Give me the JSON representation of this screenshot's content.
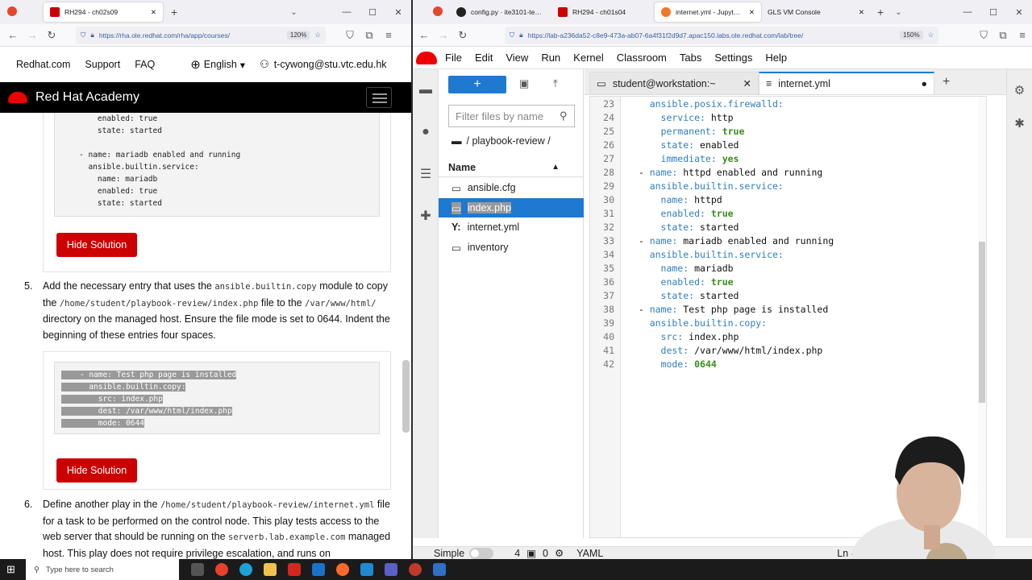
{
  "browser_left": {
    "tabs": [
      {
        "label": "RH294 - ch02s09"
      }
    ],
    "url": "https://rha.ole.redhat.com/rha/app/courses/",
    "zoom": "120%"
  },
  "browser_right": {
    "tabs": [
      {
        "label": "config.py · ite3101-testing"
      },
      {
        "label": "RH294 - ch01s04"
      },
      {
        "label": "internet.yml - JupyterLab"
      },
      {
        "label": "GLS VM Console"
      }
    ],
    "url": "https://lab-a236da52-c8e9-473a-ab07-6a4f31f2d9d7.apac150.labs.ole.redhat.com/lab/tree/",
    "zoom": "150%"
  },
  "rha": {
    "nav": {
      "home": "Redhat.com",
      "support": "Support",
      "faq": "FAQ",
      "language": "English",
      "user": "t-cywong@stu.vtc.edu.hk"
    },
    "brand": "Red Hat Academy",
    "code_top": [
      "    enabled: true",
      "    state: started",
      "",
      "- name: mariadb enabled and running",
      "  ansible.builtin.service:",
      "    name: mariadb",
      "    enabled: true",
      "    state: started"
    ],
    "hide_solution": "Hide Solution",
    "step5": {
      "num": "5.",
      "t1": "Add the necessary entry that uses the ",
      "c1": "ansible.builtin.copy",
      "t2": " module to copy the ",
      "c2": "/home/student/playbook-review/index.php",
      "t3": " file to the ",
      "c3": "/var/www/html/",
      "t4": " directory on the managed host. Ensure the file mode is set to 0644. Indent the beginning of these entries four spaces."
    },
    "code_step5": [
      "    - name: Test php page is installed",
      "      ansible.builtin.copy:",
      "        src: index.php",
      "        dest: /var/www/html/index.php",
      "        mode: 0644"
    ],
    "step6": {
      "num": "6.",
      "t1": "Define another play in the ",
      "c1": "/home/student/playbook-review/internet.yml",
      "t2": " file for a task to be performed on the control node. This play tests access to the web server that should be running on the ",
      "c2": "serverb.lab.example.com",
      "t3": " managed host. This play does not require privilege escalation, and runs on"
    }
  },
  "jupyter": {
    "menu": [
      "File",
      "Edit",
      "View",
      "Run",
      "Kernel",
      "Classroom",
      "Tabs",
      "Settings",
      "Help"
    ],
    "filter_placeholder": "Filter files by name",
    "path": "/ playbook-review /",
    "col_name": "Name",
    "files": [
      {
        "name": "ansible.cfg",
        "icon": "file-icon"
      },
      {
        "name": "index.php",
        "icon": "file-icon"
      },
      {
        "name": "internet.yml",
        "icon": "yaml-icon"
      },
      {
        "name": "inventory",
        "icon": "file-icon"
      }
    ],
    "editor_tabs": [
      {
        "label": "student@workstation:~"
      },
      {
        "label": "internet.yml"
      }
    ],
    "status": {
      "mode": "Simple",
      "n1": "4",
      "n2": "0",
      "lang": "YAML",
      "position": "Ln 42"
    }
  },
  "taskbar": {
    "search_placeholder": "Type here to search"
  },
  "colors": {
    "accent": "#1e7ad1",
    "rh_red": "#c00",
    "key": "#2f7ebd",
    "bool": "#3a8c1e"
  }
}
